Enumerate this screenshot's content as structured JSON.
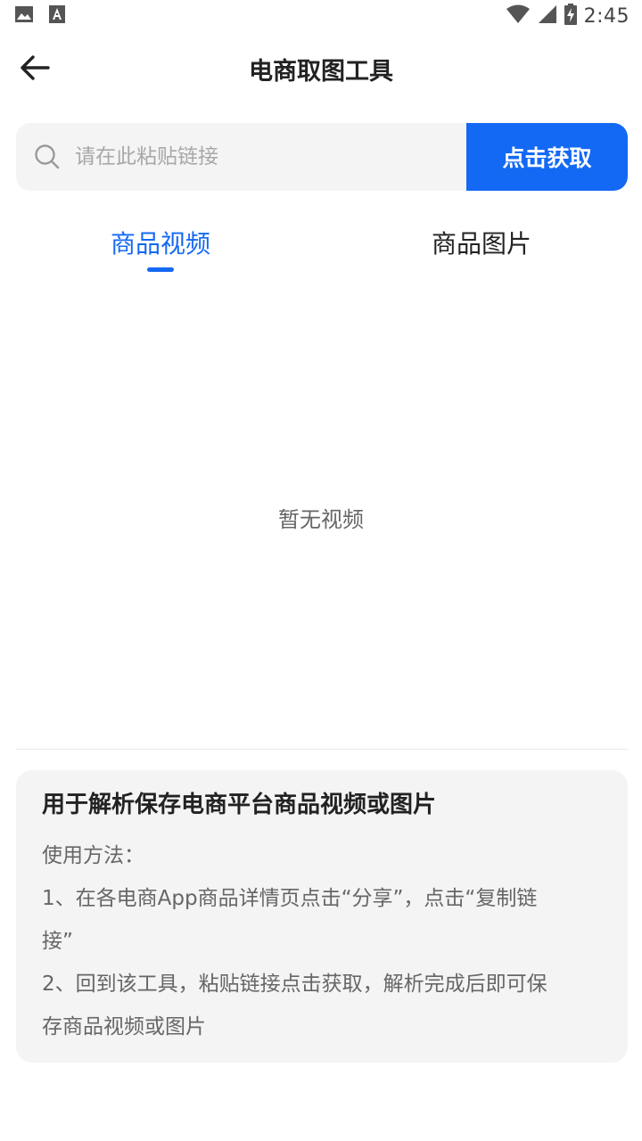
{
  "status_bar": {
    "time": "2:45",
    "icons": [
      "image-icon",
      "font-icon",
      "wifi-icon",
      "cellular-signal-icon",
      "battery-charging-icon"
    ]
  },
  "header": {
    "title": "电商取图工具",
    "back_icon": "arrow-left-icon"
  },
  "search": {
    "placeholder": "请在此粘贴链接",
    "value": "",
    "icon": "search-icon",
    "button_label": "点击获取"
  },
  "tabs": [
    {
      "label": "商品视频",
      "active": true
    },
    {
      "label": "商品图片",
      "active": false
    }
  ],
  "empty_state": {
    "text": "暂无视频"
  },
  "info": {
    "title": "用于解析保存电商平台商品视频或图片",
    "usage_label": "使用方法：",
    "step1_line1": "1、在各电商App商品详情页点击“分享”，点击“复制链",
    "step1_line2": "接”",
    "step2_line1": "2、回到该工具，粘贴链接点击获取，解析完成后即可保",
    "step2_line2": "存商品视频或图片"
  },
  "colors": {
    "accent": "#1469f4",
    "card_bg": "#f4f4f4",
    "text_primary": "#222222",
    "text_secondary": "#666666",
    "placeholder": "#a8a8a8"
  }
}
